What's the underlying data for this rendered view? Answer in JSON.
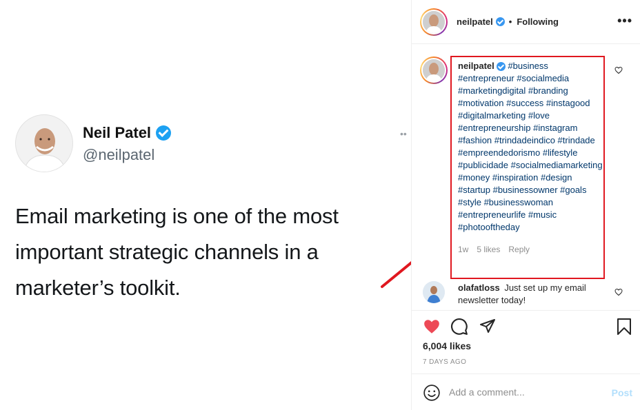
{
  "tweet": {
    "name": "Neil Patel",
    "handle": "@neilpatel",
    "text": "Email marketing is one of the most important strategic channels in a marketer’s toolkit."
  },
  "post": {
    "header": {
      "username": "neilpatel",
      "separator": "•",
      "follow_status": "Following"
    },
    "caption": {
      "username": "neilpatel",
      "hashtags": "#business #entrepreneur #socialmedia #marketingdigital #branding #motivation #success #instagood #digitalmarketing #love #entrepreneurship #instagram #fashion #trindadeindico #trindade #empreendedorismo #lifestyle #publicidade #socialmediamarketing #money #inspiration #design #startup #businessowner #goals #style #businesswoman #entrepreneurlife #music #photooftheday",
      "time": "1w",
      "likes": "5 likes",
      "reply": "Reply"
    },
    "comment": {
      "username": "olafatloss",
      "text": "Just set up my email newsletter today!"
    },
    "likes_text": "6,004 likes",
    "time_ago": "7 DAYS AGO",
    "add_comment": {
      "placeholder": "Add a comment...",
      "post_label": "Post"
    }
  },
  "colors": {
    "highlight": "#e0171f",
    "like": "#ed4956",
    "hashtag": "#00376b",
    "verified_ig": "#3897f0",
    "verified_twitter": "#1da1f2"
  },
  "icons": [
    "verified-badge-icon",
    "more-options-icon",
    "heart-icon",
    "comment-icon",
    "share-icon",
    "bookmark-icon",
    "emoji-icon",
    "arrow-annotation"
  ]
}
